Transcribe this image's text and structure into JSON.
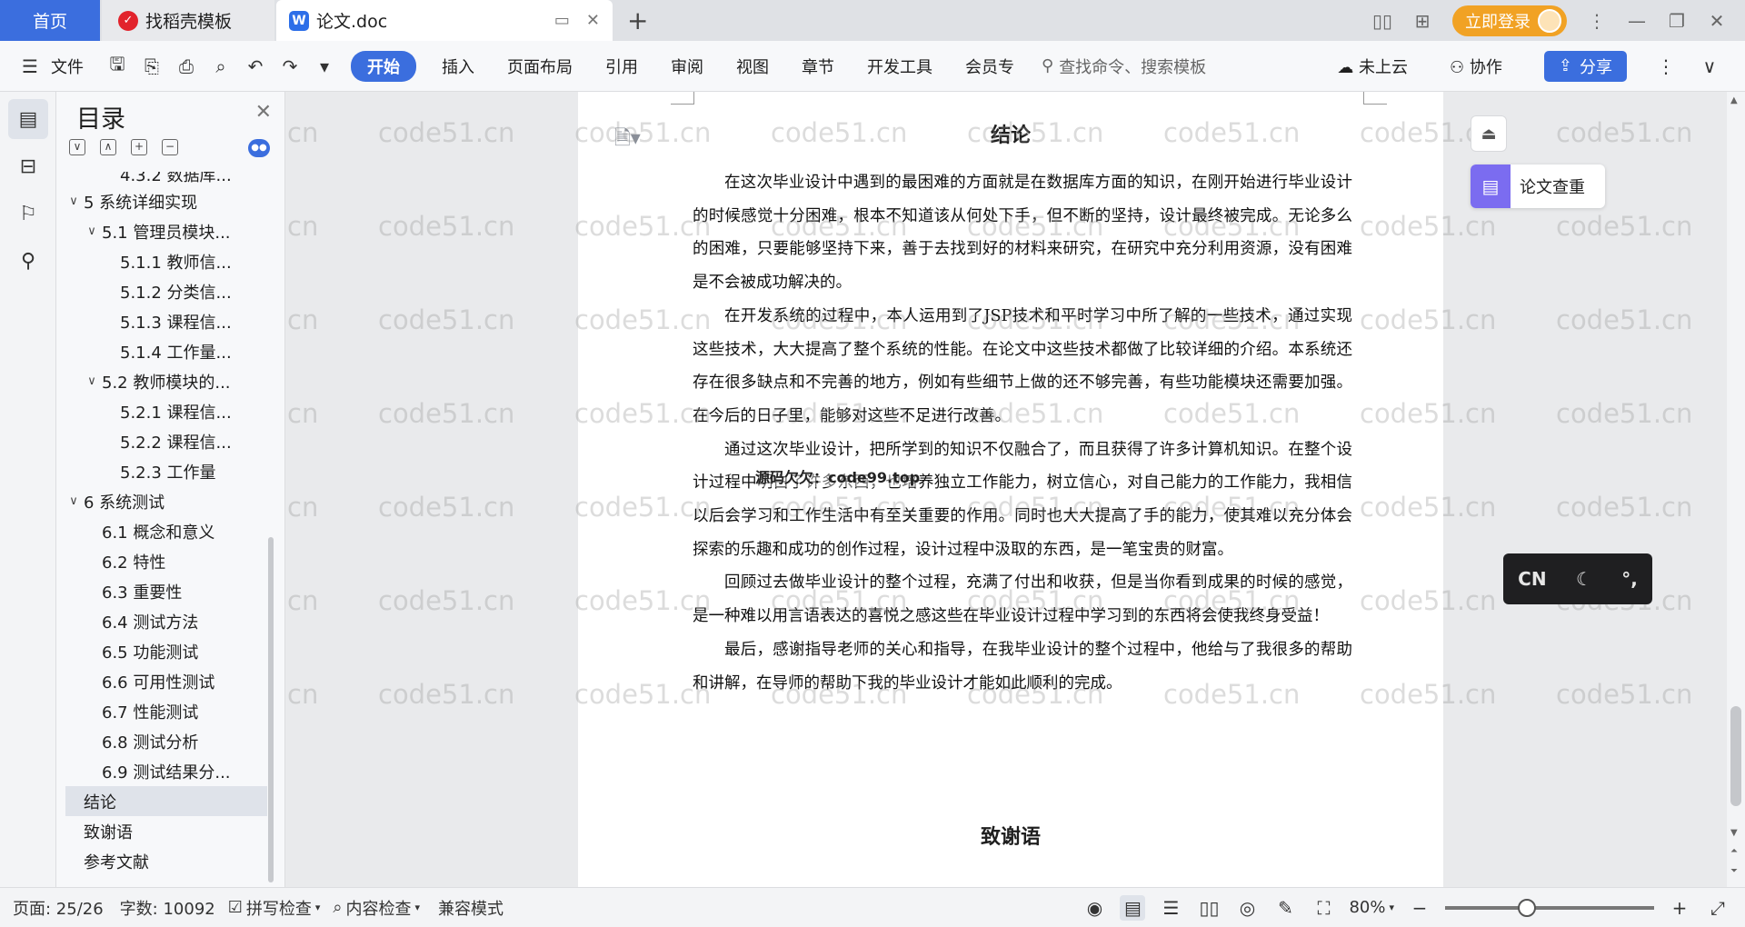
{
  "tabs": {
    "home": "首页",
    "templates": "找稻壳模板",
    "document": "论文.doc"
  },
  "titlebar": {
    "login": "立即登录"
  },
  "menu": {
    "file": "文件",
    "items": [
      "开始",
      "插入",
      "页面布局",
      "引用",
      "审阅",
      "视图",
      "章节",
      "开发工具",
      "会员专"
    ],
    "search_placeholder": "查找命令、搜索模板",
    "cloud": "未上云",
    "collab": "协作",
    "share": "分享"
  },
  "toc": {
    "title": "目录",
    "items": [
      {
        "label": "4.3.2 数据库...",
        "level": 2,
        "arrow": ""
      },
      {
        "label": "5 系统详细实现",
        "level": 0,
        "arrow": "∨"
      },
      {
        "label": "5.1 管理员模块...",
        "level": 1,
        "arrow": "∨"
      },
      {
        "label": "5.1.1 教师信...",
        "level": 2,
        "arrow": ""
      },
      {
        "label": "5.1.2 分类信...",
        "level": 2,
        "arrow": ""
      },
      {
        "label": "5.1.3 课程信...",
        "level": 2,
        "arrow": ""
      },
      {
        "label": "5.1.4 工作量...",
        "level": 2,
        "arrow": ""
      },
      {
        "label": "5.2 教师模块的...",
        "level": 1,
        "arrow": "∨"
      },
      {
        "label": "5.2.1 课程信...",
        "level": 2,
        "arrow": ""
      },
      {
        "label": "5.2.2 课程信...",
        "level": 2,
        "arrow": ""
      },
      {
        "label": "5.2.3 工作量",
        "level": 2,
        "arrow": ""
      },
      {
        "label": "6 系统测试",
        "level": 0,
        "arrow": "∨"
      },
      {
        "label": "6.1 概念和意义",
        "level": 1,
        "arrow": ""
      },
      {
        "label": "6.2 特性",
        "level": 1,
        "arrow": ""
      },
      {
        "label": "6.3 重要性",
        "level": 1,
        "arrow": ""
      },
      {
        "label": "6.4 测试方法",
        "level": 1,
        "arrow": ""
      },
      {
        "label": "6.5 功能测试",
        "level": 1,
        "arrow": ""
      },
      {
        "label": "6.6 可用性测试",
        "level": 1,
        "arrow": ""
      },
      {
        "label": "6.7 性能测试",
        "level": 1,
        "arrow": ""
      },
      {
        "label": "6.8 测试分析",
        "level": 1,
        "arrow": ""
      },
      {
        "label": "6.9 测试结果分...",
        "level": 1,
        "arrow": ""
      },
      {
        "label": "结论",
        "level": 0,
        "arrow": "",
        "selected": true
      },
      {
        "label": "致谢语",
        "level": 0,
        "arrow": ""
      },
      {
        "label": "参考文献",
        "level": 0,
        "arrow": ""
      }
    ]
  },
  "document": {
    "heading": "结论",
    "paragraphs": [
      "在这次毕业设计中遇到的最困难的方面就是在数据库方面的知识，在刚开始进行毕业设计的时候感觉十分困难，根本不知道该从何处下手，但不断的坚持，设计最终被完成。无论多么的困难，只要能够坚持下来，善于去找到好的材料来研究，在研究中充分利用资源，没有困难是不会被成功解决的。",
      "在开发系统的过程中，本人运用到了JSP技术和平时学习中所了解的一些技术，通过实现这些技术，大大提高了整个系统的性能。在论文中这些技术都做了比较详细的介绍。本系统还存在很多缺点和不完善的地方，例如有些细节上做的还不够完善，有些功能模块还需要加强。在今后的日子里，能够对这些不足进行改善。",
      "通过这次毕业设计，把所学到的知识不仅融合了，而且获得了许多计算机知识。在整个设计过程中明白了许多东西，也培养独立工作能力，树立信心，对自己能力的工作能力，我相信以后会学习和工作生活中有至关重要的作用。同时也大大提高了手的能力，使其难以充分体会探索的乐趣和成功的创作过程，设计过程中汲取的东西，是一笔宝贵的财富。",
      "回顾过去做毕业设计的整个过程，充满了付出和收获，但是当你看到成果的时候的感觉，是一种难以用言语表达的喜悦之感这些在毕业设计过程中学习到的东西将会使我终身受益！",
      "最后，感谢指导老师的关心和指导，在我毕业设计的整个过程中，他给与了我很多的帮助和讲解，在导师的帮助下我的毕业设计才能如此顺利的完成。"
    ],
    "inline_watermark": "源码欠欠：code99.top",
    "next_heading": "致谢语",
    "watermark": "code51.cn"
  },
  "side": {
    "plagiarism_check": "论文查重"
  },
  "ime": {
    "lang": "CN",
    "moon": "☾",
    "punct": "°,"
  },
  "status": {
    "page": "页面: 25/26",
    "words": "字数: 10092",
    "spell": "拼写检查",
    "content_check": "内容检查",
    "compat": "兼容模式",
    "zoom": "80%"
  }
}
